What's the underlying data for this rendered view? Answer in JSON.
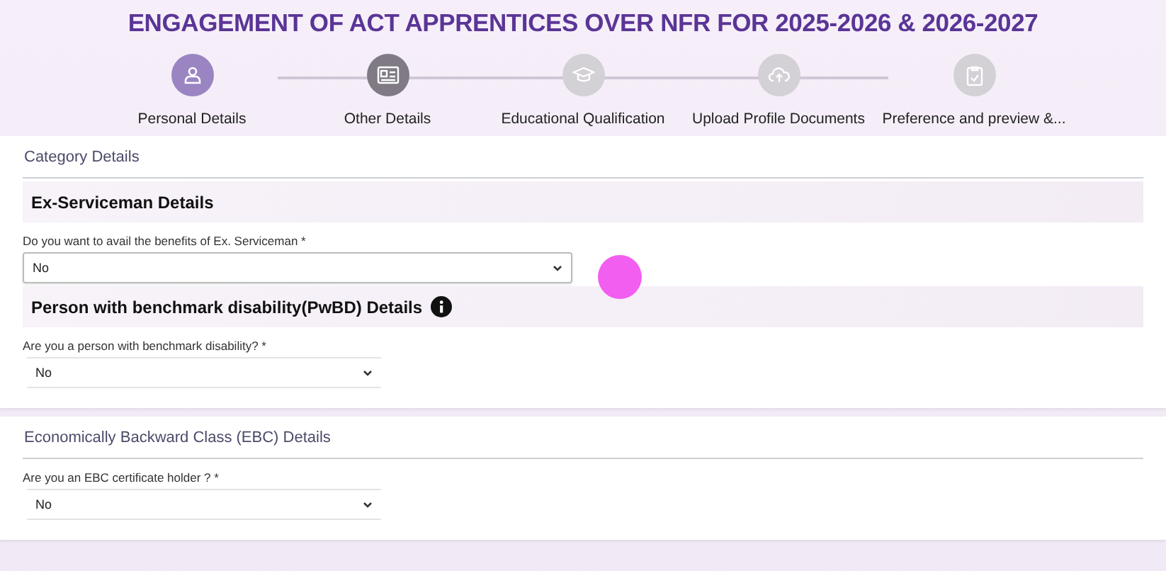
{
  "title": "ENGAGEMENT OF ACT APPRENTICES OVER NFR FOR 2025-2026 & 2026-2027",
  "steps": [
    {
      "label": "Personal Details",
      "selected": true,
      "visited": true
    },
    {
      "label": "Other Details",
      "selected": false,
      "visited": true
    },
    {
      "label": "Educational Qualification",
      "selected": false,
      "visited": false
    },
    {
      "label": "Upload Profile Documents",
      "selected": false,
      "visited": false
    },
    {
      "label": "Preference and preview &...",
      "selected": false,
      "visited": false
    }
  ],
  "panels": [
    {
      "title": "Category Details",
      "groups": [
        {
          "heading": "Ex-Serviceman Details",
          "info": false,
          "fields": [
            {
              "label": "Do you want to avail the benefits of Ex. Serviceman *",
              "value": "No",
              "kind": "boxed"
            }
          ]
        },
        {
          "heading": "Person with benchmark disability(PwBD) Details",
          "info": true,
          "fields": [
            {
              "label": "Are you a person with benchmark disability? *",
              "value": "No",
              "kind": "lined"
            }
          ]
        }
      ]
    },
    {
      "title": "Economically Backward Class (EBC) Details",
      "groups": [
        {
          "fields": [
            {
              "label": "Are you an EBC certificate holder ? *",
              "value": "No",
              "kind": "lined"
            }
          ]
        }
      ]
    }
  ]
}
